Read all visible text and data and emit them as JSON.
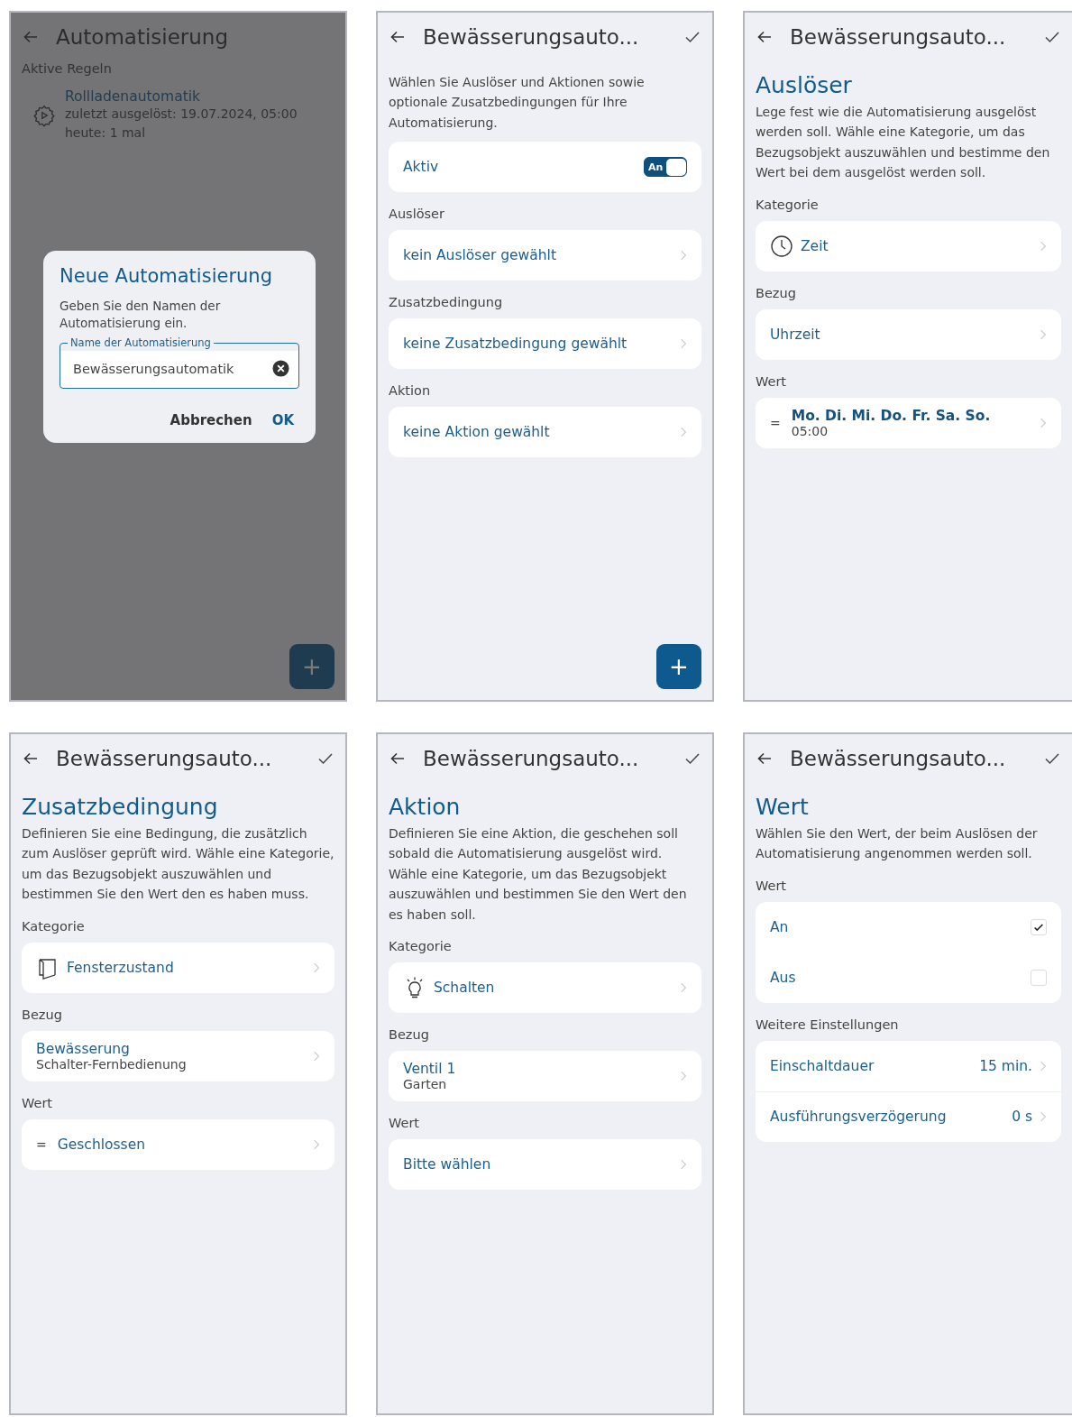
{
  "screens": [
    {
      "kind": "rules",
      "dimmed": true,
      "title": "Automatisierung",
      "section_label": "Aktive Regeln",
      "rules": [
        {
          "name": "Rollladenautomatik",
          "details": [
            "zuletzt ausgelöst: 19.07.2024, 05:00",
            "heute: 1 mal"
          ]
        }
      ],
      "dialog": {
        "title": "Neue Automatisierung",
        "text": "Geben Sie den Namen der Automatisierung ein.",
        "field": {
          "label": "Name der Automatisierung",
          "value": "Bewässerungsautomatik"
        },
        "buttons": [
          {
            "label": "Abbrechen",
            "kind": "secondary"
          },
          {
            "label": "OK",
            "kind": "primary"
          }
        ]
      },
      "fab": "+"
    },
    {
      "kind": "editor",
      "dimmed": false,
      "title": "Bewässerungsauto...",
      "intro": "Wählen Sie Auslöser und Aktionen sowie optionale Zusatzbedingungen für Ihre Automatisierung.",
      "groups": [
        {
          "rows": [
            {
              "kind": "toggle",
              "primary": "Aktiv",
              "switch_text": "An",
              "on": true
            }
          ]
        },
        {
          "label": "Auslöser",
          "rows": [
            {
              "kind": "link",
              "primary": "kein Auslöser gewählt"
            }
          ]
        },
        {
          "label": "Zusatzbedingung",
          "rows": [
            {
              "kind": "link",
              "primary": "keine Zusatzbedingung gewählt"
            }
          ]
        },
        {
          "label": "Aktion",
          "rows": [
            {
              "kind": "link",
              "primary": "keine Aktion gewählt"
            }
          ]
        }
      ],
      "fab": "+"
    },
    {
      "kind": "editor",
      "dimmed": false,
      "title": "Bewässerungsauto...",
      "heading": "Auslöser",
      "intro": "Lege fest wie die Automatisierung ausgelöst werden soll. Wähle eine Kategorie, um das Bezugsobjekt auszuwählen und bestimme den Wert bei dem ausgelöst werden soll.",
      "groups": [
        {
          "label": "Kategorie",
          "rows": [
            {
              "kind": "time",
              "primary": "Zeit"
            }
          ]
        },
        {
          "label": "Bezug",
          "rows": [
            {
              "kind": "link",
              "primary": "Uhrzeit"
            }
          ]
        },
        {
          "label": "Wert",
          "rows": [
            {
              "kind": "schedule",
              "prefix": "=",
              "primary": "Mo. Di. Mi. Do. Fr. Sa. So.",
              "secondary": "05:00"
            }
          ]
        }
      ]
    },
    {
      "kind": "editor",
      "dimmed": false,
      "title": "Bewässerungsauto...",
      "heading": "Zusatzbedingung",
      "intro": "Definieren Sie eine Bedingung, die zusätzlich zum Auslöser geprüft wird. Wähle eine Kategorie, um das Bezugsobjekt auszuwählen und bestimmen Sie den Wert den es haben muss.",
      "groups": [
        {
          "label": "Kategorie",
          "rows": [
            {
              "kind": "window",
              "primary": "Fensterzustand"
            }
          ]
        },
        {
          "label": "Bezug",
          "rows": [
            {
              "kind": "link",
              "primary": "Bewässerung",
              "secondary": "Schalter-Fernbedienung"
            }
          ]
        },
        {
          "label": "Wert",
          "rows": [
            {
              "kind": "link",
              "prefix": "=",
              "primary": "Geschlossen"
            }
          ]
        }
      ]
    },
    {
      "kind": "editor",
      "dimmed": false,
      "title": "Bewässerungsauto...",
      "heading": "Aktion",
      "intro": "Definieren Sie eine Aktion, die geschehen soll sobald die Automatisierung ausgelöst wird. Wähle eine Kategorie, um das Bezugsobjekt auszuwählen und bestimmen Sie den Wert den es haben soll.",
      "groups": [
        {
          "label": "Kategorie",
          "rows": [
            {
              "kind": "switch",
              "primary": "Schalten"
            }
          ]
        },
        {
          "label": "Bezug",
          "rows": [
            {
              "kind": "link",
              "primary": "Ventil 1",
              "secondary": "Garten"
            }
          ]
        },
        {
          "label": "Wert",
          "rows": [
            {
              "kind": "link",
              "primary": "Bitte wählen"
            }
          ]
        }
      ]
    },
    {
      "kind": "editor",
      "dimmed": false,
      "title": "Bewässerungsauto...",
      "heading": "Wert",
      "intro": "Wählen Sie den Wert, der beim Auslösen der Automatisierung angenommen werden soll.",
      "groups": [
        {
          "label": "Wert",
          "rows": [
            {
              "kind": "check",
              "primary": "An",
              "checked": true
            },
            {
              "kind": "check",
              "primary": "Aus",
              "checked": false
            }
          ]
        },
        {
          "label": "Weitere Einstellungen",
          "rows": [
            {
              "kind": "link",
              "primary": "Einschaltdauer",
              "value": "15 min."
            },
            {
              "kind": "link",
              "primary": "Ausführungsverzögerung",
              "value": "0 s"
            }
          ]
        }
      ]
    }
  ]
}
